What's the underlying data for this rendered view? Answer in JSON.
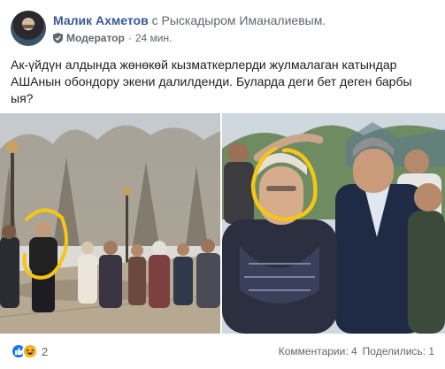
{
  "post": {
    "author_name": "Малик Ахметов",
    "with_text": "с Рыскадыром Иманалиевым.",
    "role": "Модератор",
    "separator": "·",
    "time": "24 мин.",
    "body_text": "Ак-үйдүн алдында жөнөкөй кызматкерлерди жулмалаган катындар АШАнын обондору экени далилденди. Буларда деги бет деген барбы ыя?"
  },
  "photos": {
    "left_icon": "crowd-street-photo",
    "right_icon": "woman-and-politician-photo",
    "highlight_color": "#f5c518"
  },
  "footer": {
    "reaction_icons": [
      "like-icon",
      "haha-icon"
    ],
    "reaction_count": "2",
    "comments": "Комментарии: 4",
    "shares": "Поделились: 1"
  },
  "colors": {
    "link": "#385898",
    "muted": "#606770",
    "like": "#1877f2",
    "haha": "#f7b125"
  }
}
